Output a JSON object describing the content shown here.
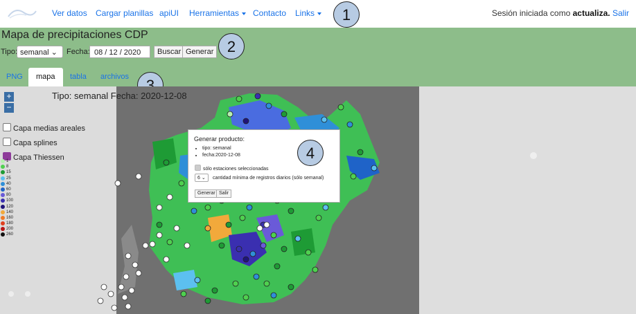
{
  "navbar": {
    "links": [
      "Ver datos",
      "Cargar planillas",
      "apiUI",
      "Herramientas",
      "Contacto",
      "Links"
    ],
    "session_prefix": "Sesión iniciada como",
    "session_user": "actualiza.",
    "logout": "Salir"
  },
  "callouts": [
    "1",
    "2",
    "3",
    "4"
  ],
  "panel": {
    "title": "Mapa de precipitaciones CDP",
    "tipo_label": "Tipo:",
    "tipo_value": "semanal",
    "fecha_label": "Fecha:",
    "fecha_value": "08 / 12 / 2020",
    "buscar": "Buscar",
    "generar": "Generar"
  },
  "tabs": [
    {
      "label": "PNG",
      "active": false
    },
    {
      "label": "mapa",
      "active": true
    },
    {
      "label": "tabla",
      "active": false
    },
    {
      "label": "archivos",
      "active": false
    }
  ],
  "map": {
    "caption": "Tipo: semanal Fecha: 2020-12-08",
    "zoom_in": "+",
    "zoom_out": "−",
    "layers": [
      {
        "label": "Capa medias areales",
        "checked": false
      },
      {
        "label": "Capa splines",
        "checked": false
      },
      {
        "label": "Capa Thiessen",
        "checked": true
      }
    ],
    "legend": [
      {
        "value": "1",
        "color": "#b6f0b0"
      },
      {
        "value": "8",
        "color": "#4fd04f"
      },
      {
        "value": "15",
        "color": "#1e9b35"
      },
      {
        "value": "25",
        "color": "#5cc0f0"
      },
      {
        "value": "40",
        "color": "#2f8fd8"
      },
      {
        "value": "60",
        "color": "#1f63c8"
      },
      {
        "value": "80",
        "color": "#6a5ad8"
      },
      {
        "value": "100",
        "color": "#3a2fb0"
      },
      {
        "value": "120",
        "color": "#20147a"
      },
      {
        "value": "140",
        "color": "#f2a93b"
      },
      {
        "value": "160",
        "color": "#f07a26"
      },
      {
        "value": "180",
        "color": "#e0401e"
      },
      {
        "value": "200",
        "color": "#b81414"
      },
      {
        "value": "260",
        "color": "#111111"
      }
    ]
  },
  "popup": {
    "title": "Generar producto:",
    "items": [
      "tipo: semanal",
      "fecha:2020-12-08"
    ],
    "checkbox_label": "sólo estaciones seleccionadas",
    "min_value": "6",
    "min_label": "cantidad mínima de registros diarios (sólo semanal)",
    "generar": "Generar",
    "salir": "Salir"
  },
  "colors": {
    "panel_bg": "#8dbd8a",
    "link": "#1a73e8",
    "callout_bg": "#b7cbe3",
    "checked": "#8e3c9a"
  }
}
